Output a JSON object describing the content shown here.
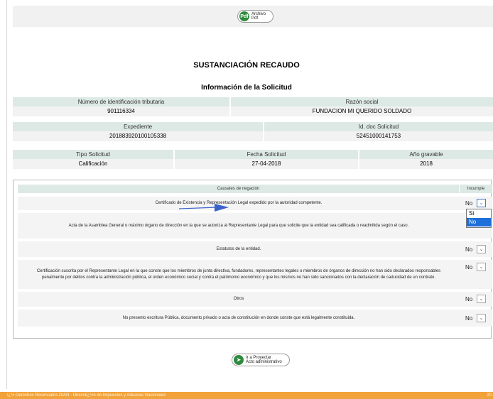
{
  "toolbar": {
    "pdf_icon": "Pdf",
    "pdf_label": "Archivo\nPdf"
  },
  "title": "SUSTANCIACIÓN RECAUDO",
  "subtitle": "Información de la Solicitud",
  "info": {
    "nit_label": "Número de identificación tributaria",
    "nit_value": "901116334",
    "razon_label": "Razón social",
    "razon_value": "FUNDACION MI QUERIDO SOLDADO",
    "expediente_label": "Expediente",
    "expediente_value": "201883920100105338",
    "doc_label": "Id. doc Solicitud",
    "doc_value": "52451000141753",
    "tipo_label": "Tipo Solicitud",
    "tipo_value": "Calificación",
    "fecha_label": "Fecha Solicitud",
    "fecha_value": "27-04-2018",
    "anio_label": "Año gravable",
    "anio_value": "2018"
  },
  "causales": {
    "header_label": "Causales de negación",
    "incumple_label": "Incumple",
    "rows": [
      {
        "text": "Certificado de Existencia y Representación Legal expedido por la autoridad competente.",
        "value": "No"
      },
      {
        "text": "Acta de la Asamblea General o máximo órgano de dirección en la que se autoriza al Representante Legal para que solicite que la entidad sea calificada o readmitida según el caso.",
        "value": ""
      },
      {
        "text": "Estatutos de la entidad.",
        "value": "No"
      },
      {
        "text": "Certificación suscrita por el Representante Legal en la que conste que los miembros de junta directiva, fundadores, representantes legales o miembros de órganos de dirección no han sido declarados responsables penalmente por delitos contra la administración pública, el orden económico social y contra el patrimonio económico y que los mismos no han sido sancionados con la declaración de caducidad de un contrato.",
        "value": "No"
      },
      {
        "text": "Otros",
        "value": "No"
      },
      {
        "text": "No presento escritura Pública, documento privado o acta de constitución en donde conste que está legalmente constituida.",
        "value": "No"
      }
    ],
    "dropdown_options": [
      "Si",
      "No"
    ]
  },
  "bottom_button": {
    "label": "Ir a Proyectar\nActo administrativo"
  },
  "footer": {
    "text": "ï¿½ Derechos Reservados DIAN - Direcciï¿½n de Impuestos y Aduanas Nacionales",
    "year": "20"
  }
}
